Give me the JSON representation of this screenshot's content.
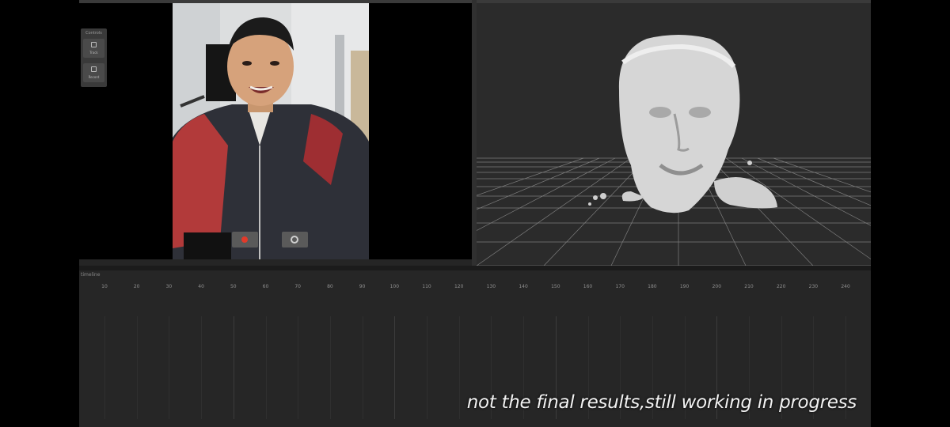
{
  "panels": {
    "camera_label": "",
    "viewport_label": "",
    "timeline_label": "timeline"
  },
  "toolbar": {
    "title": "Controls",
    "buttons": [
      {
        "label": "Track",
        "icon": "square-icon"
      },
      {
        "label": "Record",
        "icon": "square-icon"
      }
    ]
  },
  "camera_controls": {
    "record_icon": "record-icon",
    "snapshot_icon": "camera-icon",
    "record_color": "#e23a2a"
  },
  "timeline": {
    "ticks": [
      "10",
      "20",
      "30",
      "40",
      "50",
      "60",
      "70",
      "80",
      "90",
      "100",
      "110",
      "120",
      "130",
      "140",
      "150",
      "160",
      "170",
      "180",
      "190",
      "200",
      "210",
      "220",
      "230",
      "240"
    ]
  },
  "subtitle": "not the final results,still working in progress",
  "colors": {
    "background": "#252525",
    "viewport": "#2b2b2b",
    "mesh": "#d9d9d9",
    "grid": "#8a8a8a"
  }
}
